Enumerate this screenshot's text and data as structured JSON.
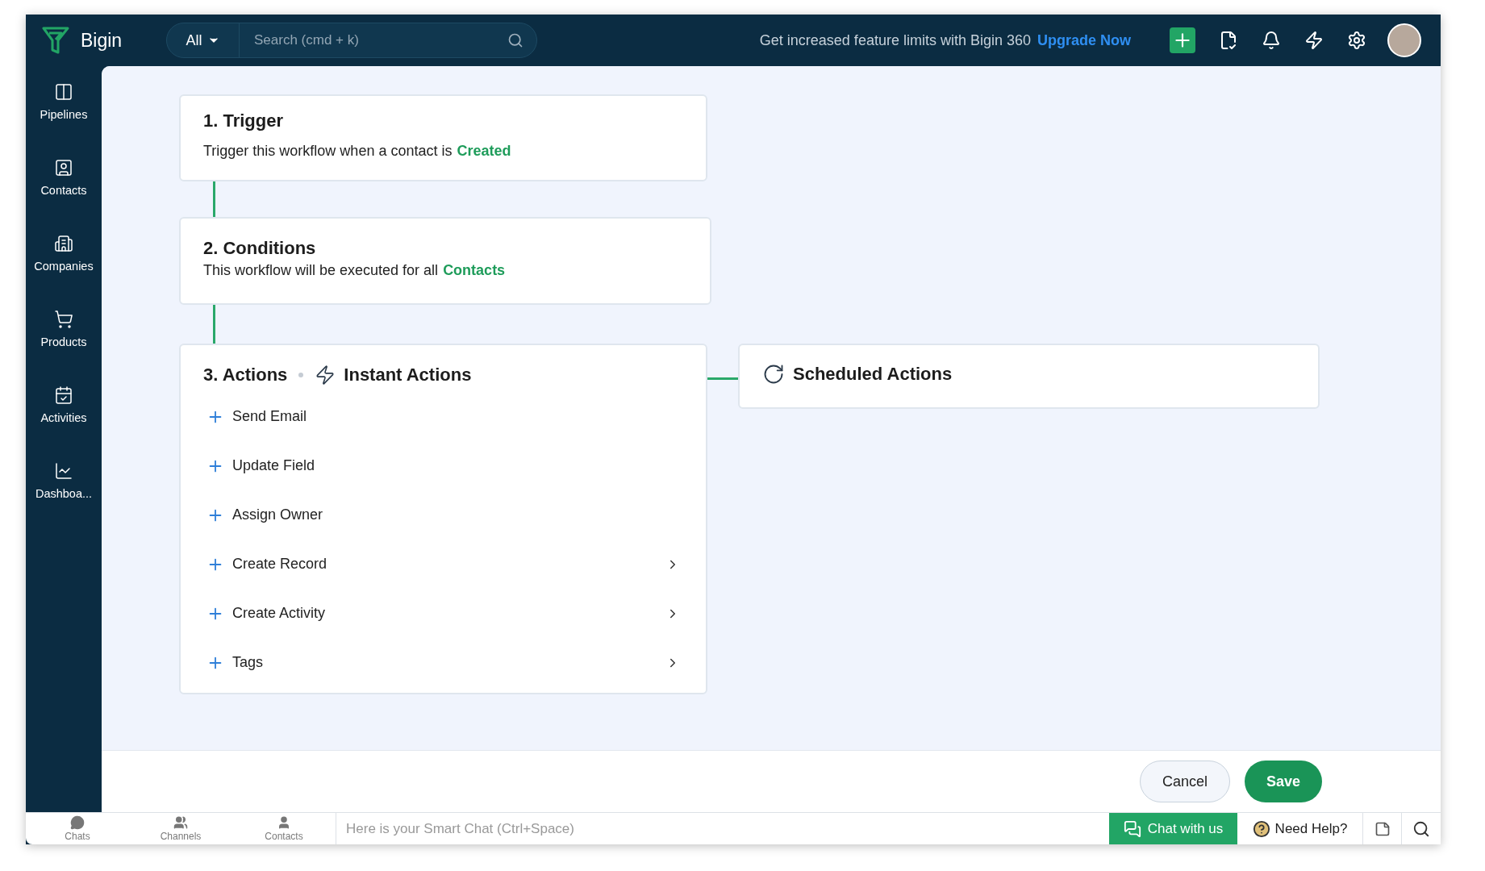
{
  "app": {
    "name": "Bigin"
  },
  "search": {
    "scope": "All",
    "placeholder": "Search (cmd + k)"
  },
  "promo": {
    "text": "Get increased feature limits with Bigin 360",
    "link": "Upgrade Now"
  },
  "sidebar": {
    "items": [
      {
        "label": "Pipelines",
        "kind": "pipelines"
      },
      {
        "label": "Contacts",
        "kind": "contacts"
      },
      {
        "label": "Companies",
        "kind": "companies"
      },
      {
        "label": "Products",
        "kind": "products"
      },
      {
        "label": "Activities",
        "kind": "activities"
      },
      {
        "label": "Dashboa...",
        "kind": "dashboards"
      }
    ]
  },
  "trigger": {
    "title": "1. Trigger",
    "text": "Trigger this workflow when a contact is",
    "value": "Created"
  },
  "conditions": {
    "title": "2. Conditions",
    "text": "This workflow will be executed for all",
    "value": "Contacts"
  },
  "actions": {
    "title": "3. Actions",
    "instant_title": "Instant Actions",
    "items": [
      {
        "label": "Send Email",
        "has_submenu": false
      },
      {
        "label": "Update Field",
        "has_submenu": false
      },
      {
        "label": "Assign Owner",
        "has_submenu": false
      },
      {
        "label": "Create Record",
        "has_submenu": true
      },
      {
        "label": "Create Activity",
        "has_submenu": true
      },
      {
        "label": "Tags",
        "has_submenu": true
      }
    ]
  },
  "scheduled": {
    "title": "Scheduled Actions"
  },
  "footer": {
    "buttons": [
      {
        "label": "Cancel",
        "kind": "secondary"
      },
      {
        "label": "Save",
        "kind": "primary"
      }
    ]
  },
  "bottom_bar": {
    "tabs": [
      {
        "label": "Chats",
        "kind": "chats"
      },
      {
        "label": "Channels",
        "kind": "channels"
      },
      {
        "label": "Contacts",
        "kind": "contacts"
      }
    ],
    "smart_chat_placeholder": "Here is your Smart Chat (Ctrl+Space)",
    "chat_button": "Chat with us",
    "help": "Need Help?"
  }
}
